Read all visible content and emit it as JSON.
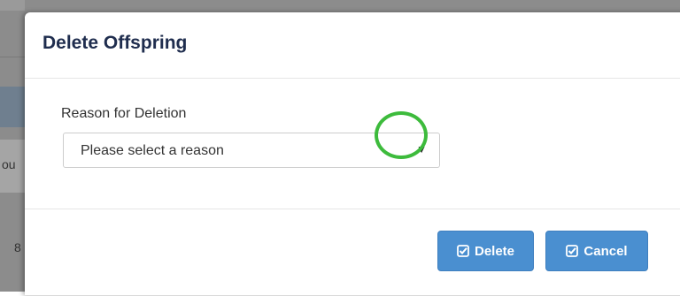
{
  "background": {
    "row_text_1": "ou",
    "row_text_2": "8"
  },
  "dialog": {
    "title": "Delete Offspring",
    "reason_label": "Reason for Deletion",
    "reason_select": {
      "selected": "Please select a reason",
      "arrow": "▼"
    },
    "buttons": {
      "delete_label": "Delete",
      "cancel_label": "Cancel"
    }
  },
  "colors": {
    "title": "#1f2d4e",
    "button_primary": "#4a8fd0",
    "highlight_ring": "#3dbb3c"
  },
  "icons": {
    "delete": "check-square-icon",
    "cancel": "check-square-icon"
  }
}
